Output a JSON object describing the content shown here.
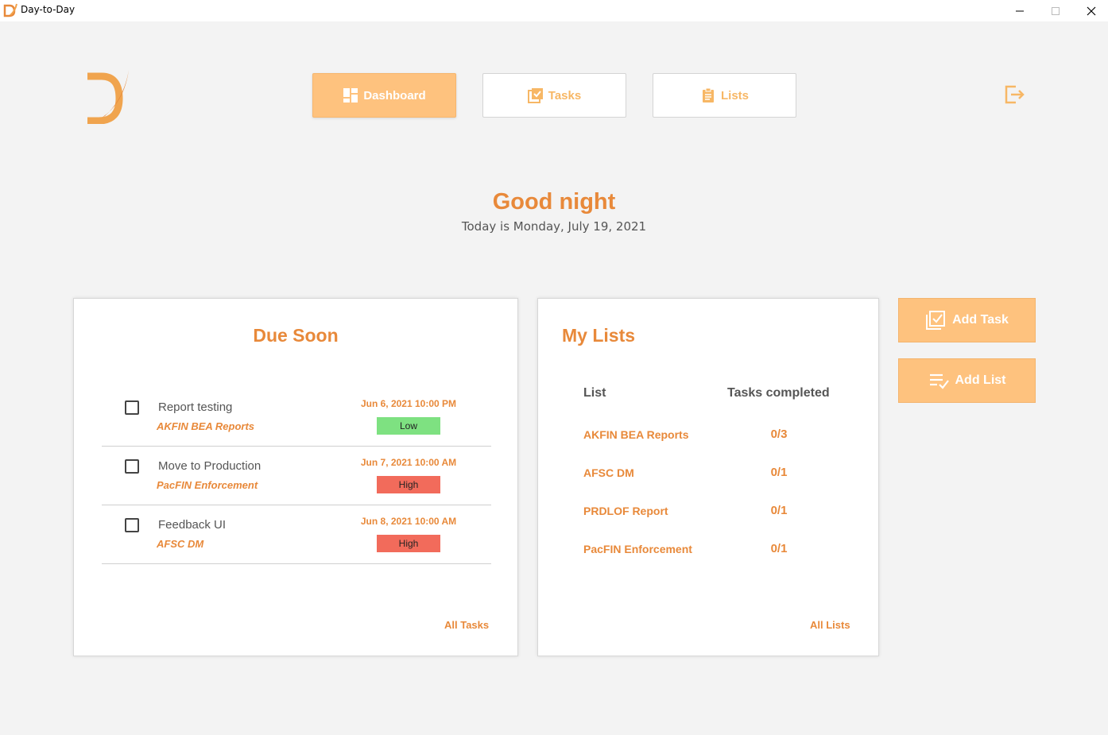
{
  "window": {
    "title": "Day-to-Day"
  },
  "nav": {
    "dashboard": "Dashboard",
    "tasks": "Tasks",
    "lists": "Lists"
  },
  "greeting": {
    "title": "Good night",
    "date": "Today is Monday, July 19, 2021"
  },
  "due_soon": {
    "title": "Due Soon",
    "tasks": [
      {
        "name": "Report testing",
        "list": "AKFIN BEA Reports",
        "due": "Jun 6, 2021 10:00 PM",
        "priority": "Low",
        "priority_color": "#7ee181"
      },
      {
        "name": "Move to Production",
        "list": "PacFIN Enforcement",
        "due": "Jun 7, 2021 10:00 AM",
        "priority": "High",
        "priority_color": "#f26b5b"
      },
      {
        "name": "Feedback UI",
        "list": "AFSC DM",
        "due": "Jun 8, 2021 10:00 AM",
        "priority": "High",
        "priority_color": "#f26b5b"
      }
    ],
    "all_link": "All Tasks"
  },
  "my_lists": {
    "title": "My Lists",
    "col_list": "List",
    "col_completed": "Tasks completed",
    "rows": [
      {
        "name": "AKFIN BEA Reports",
        "completed": "0/3"
      },
      {
        "name": "AFSC DM",
        "completed": "0/1"
      },
      {
        "name": "PRDLOF Report",
        "completed": "0/1"
      },
      {
        "name": "PacFIN Enforcement",
        "completed": "0/1"
      }
    ],
    "all_link": "All Lists"
  },
  "actions": {
    "add_task": "Add Task",
    "add_list": "Add List"
  },
  "colors": {
    "accent": "#e8893a",
    "button_fill": "#fec27e",
    "low": "#7ee181",
    "high": "#f26b5b"
  },
  "icons": [
    "app-logo",
    "dashboard-icon",
    "tasks-icon",
    "clipboard-icon",
    "logout-icon",
    "add-task-icon",
    "add-list-icon",
    "minimize-icon",
    "maximize-icon",
    "close-icon"
  ]
}
